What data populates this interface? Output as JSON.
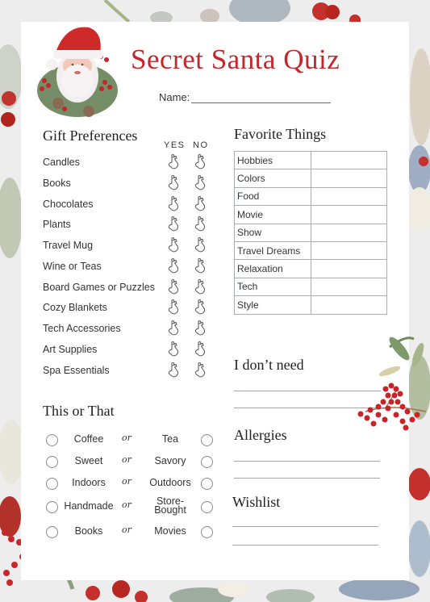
{
  "header": {
    "title": "Secret Santa Quiz",
    "name_label": "Name:"
  },
  "gift_preferences": {
    "heading": "Gift Preferences",
    "col_yes": "YES",
    "col_no": "NO",
    "icon": "stocking-icon",
    "items": [
      "Candles",
      "Books",
      "Chocolates",
      "Plants",
      "Travel Mug",
      "Wine or Teas",
      "Board Games or Puzzles",
      "Cozy Blankets",
      "Tech Accessories",
      "Art Supplies",
      "Spa Essentials"
    ]
  },
  "favorite_things": {
    "heading": "Favorite Things",
    "rows": [
      {
        "label": "Hobbies",
        "value": ""
      },
      {
        "label": "Colors",
        "value": ""
      },
      {
        "label": "Food",
        "value": ""
      },
      {
        "label": "Movie",
        "value": ""
      },
      {
        "label": "Show",
        "value": ""
      },
      {
        "label": "Travel Dreams",
        "value": ""
      },
      {
        "label": "Relaxation",
        "value": ""
      },
      {
        "label": "Tech",
        "value": ""
      },
      {
        "label": "Style",
        "value": ""
      }
    ]
  },
  "this_or_that": {
    "heading": "This or That",
    "separator": "or",
    "pairs": [
      {
        "left": "Coffee",
        "right": "Tea"
      },
      {
        "left": "Sweet",
        "right": "Savory"
      },
      {
        "left": "Indoors",
        "right": "Outdoors"
      },
      {
        "left": "Handmade",
        "right": "Store-Bought"
      },
      {
        "left": "Books",
        "right": "Movies"
      }
    ]
  },
  "dont_need": {
    "heading": "I don’t need"
  },
  "allergies": {
    "heading": "Allergies"
  },
  "wishlist": {
    "heading": "Wishlist"
  },
  "colors": {
    "title_red": "#c4262b",
    "background": "#ededed",
    "card": "#ffffff",
    "line_gray": "#a3a7ad"
  }
}
